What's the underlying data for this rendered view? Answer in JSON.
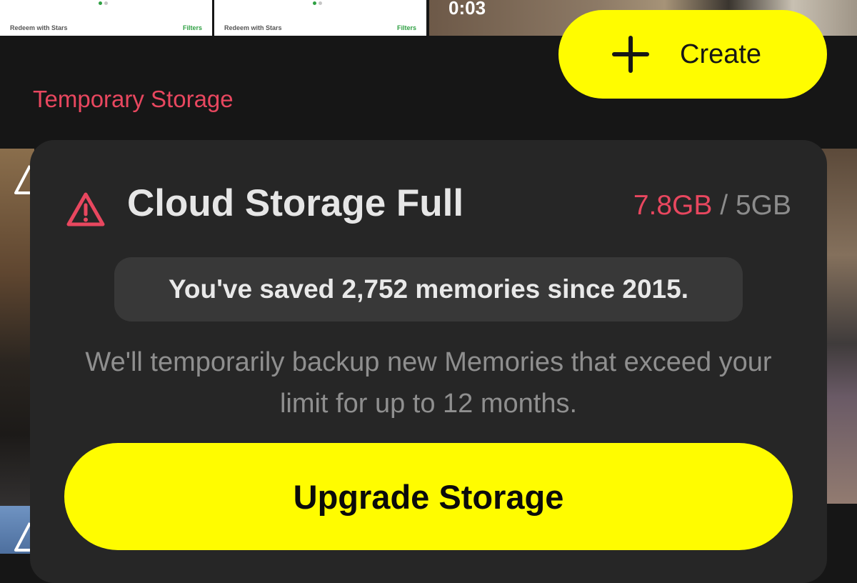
{
  "thumbnails": [
    {
      "footer_left": "Redeem with Stars",
      "footer_right": "Filters"
    },
    {
      "footer_left": "Redeem with Stars",
      "footer_right": "Filters"
    }
  ],
  "video_thumb": {
    "duration": "0:03"
  },
  "header": {
    "section_label": "Temporary Storage",
    "create_label": "Create",
    "create_icon": "plus-icon"
  },
  "storage_card": {
    "icon": "warning-triangle-icon",
    "title": "Cloud Storage Full",
    "used": "7.8GB",
    "separator": "/",
    "limit": "5GB",
    "saved_summary": "You've saved 2,752 memories since 2015.",
    "description": "We'll temporarily backup new Memories that exceed your limit for up to 12 months.",
    "upgrade_label": "Upgrade Storage"
  },
  "colors": {
    "accent_yellow": "#fffc00",
    "alert_red": "#e8475f",
    "card_bg": "#262626",
    "page_bg": "#161616"
  }
}
